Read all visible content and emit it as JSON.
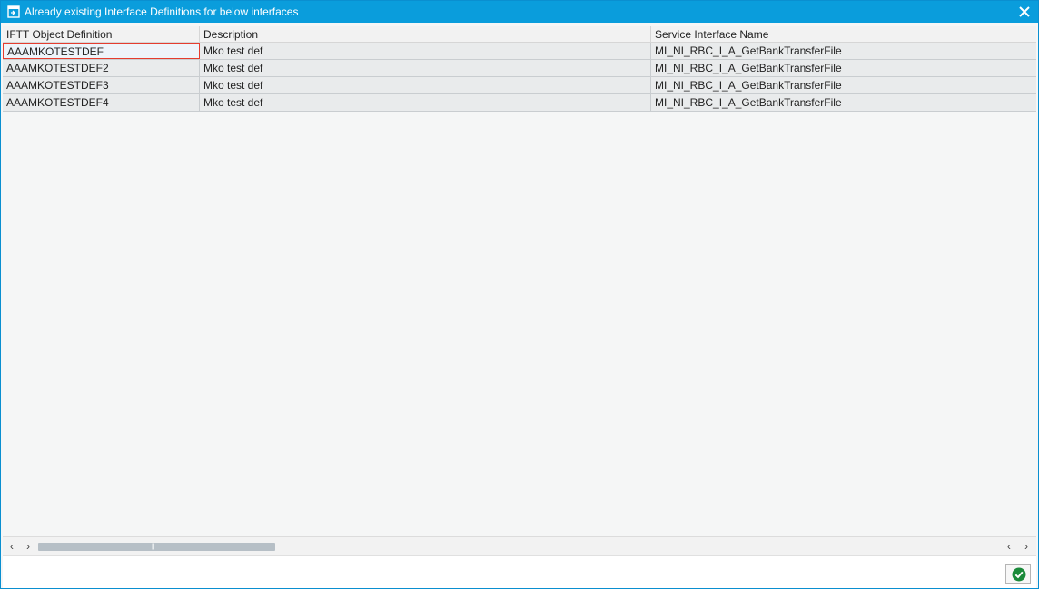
{
  "dialog": {
    "title": "Already existing Interface Definitions for below interfaces"
  },
  "table": {
    "columns": [
      "IFTT Object Definition",
      "Description",
      "Service Interface Name"
    ],
    "rows": [
      {
        "definition": "AAAMKOTESTDEF",
        "description": "Mko test def",
        "service_interface": "MI_NI_RBC_I_A_GetBankTransferFile"
      },
      {
        "definition": "AAAMKOTESTDEF2",
        "description": "Mko test def",
        "service_interface": "MI_NI_RBC_I_A_GetBankTransferFile"
      },
      {
        "definition": "AAAMKOTESTDEF3",
        "description": "Mko test def",
        "service_interface": "MI_NI_RBC_I_A_GetBankTransferFile"
      },
      {
        "definition": "AAAMKOTESTDEF4",
        "description": "Mko test def",
        "service_interface": "MI_NI_RBC_I_A_GetBankTransferFile"
      }
    ],
    "selected_row": 0
  },
  "scrollbar": {
    "left_arrow_icon": "chevron-left-icon",
    "right_arrow_icon": "chevron-right-icon",
    "left_glyph": "‹",
    "right_glyph": "›",
    "grip": "|||"
  },
  "footer": {
    "ok_icon": "checkmark-icon"
  },
  "colors": {
    "titlebar": "#0a9ddc",
    "row_background": "#e9ebec",
    "selection_border": "#e53d2f",
    "ok_green": "#1a8a3a"
  }
}
